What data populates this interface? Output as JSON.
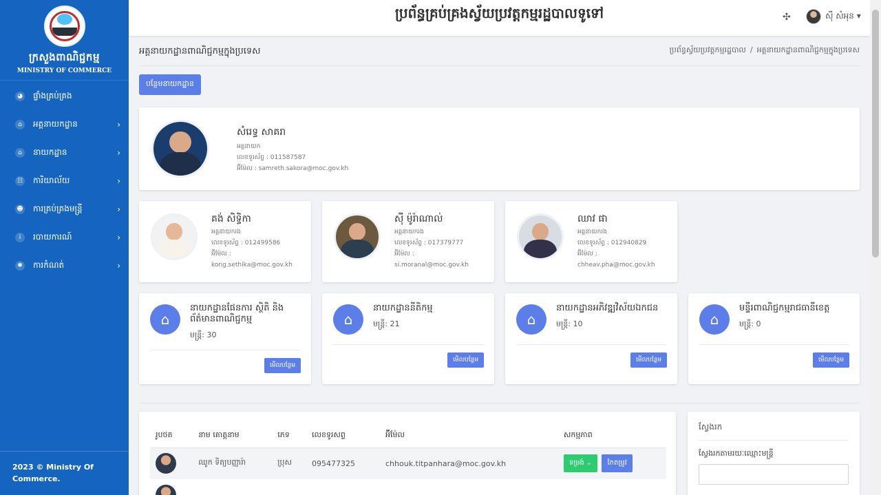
{
  "sidebar": {
    "brand_kh": "ក្រសួងពាណិជ្ជកម្ម",
    "brand_en": "MINISTRY OF COMMERCE",
    "items": [
      {
        "icon": "globe-icon",
        "glyph": "◕",
        "label": "ផ្ទាំងគ្រប់គ្រង"
      },
      {
        "icon": "bank-icon",
        "glyph": "⌂",
        "label": "អគ្គនាយកដ្ឋាន",
        "chevron": "›"
      },
      {
        "icon": "home-icon",
        "glyph": "⌂",
        "label": "នាយកដ្ឋាន",
        "chevron": "›"
      },
      {
        "icon": "sitemap-icon",
        "glyph": "☷",
        "label": "ការិយាល័យ",
        "chevron": "›"
      },
      {
        "icon": "users-icon",
        "glyph": "☻",
        "label": "ការគ្រប់គ្រងមន្ត្រី",
        "chevron": "›"
      },
      {
        "icon": "info-icon",
        "glyph": "i",
        "label": "របាយការណ៍",
        "chevron": "›"
      },
      {
        "icon": "gear-icon",
        "glyph": "✱",
        "label": "ការកំណត់",
        "chevron": "›"
      }
    ],
    "footer": "2023 © Ministry Of Commerce."
  },
  "header": {
    "title": "ប្រព័ន្ធគ្រប់គ្រងស្វ័យប្រវត្តកម្មរដ្ឋបាលទូទៅ",
    "user_name": "ស៊ី សំអុន ▾"
  },
  "page": {
    "title": "អគ្គនាយកដ្ឋានពាណិជ្ជកម្មក្នុងប្រទេស",
    "breadcrumb": [
      "ប្រព័ន្ធស្វ័យប្រវត្តកម្មរដ្ឋបាល",
      "អគ្គនាយកដ្ឋានពាណិជ្ជកម្មក្នុងប្រទេស"
    ],
    "breadcrumb_sep": "/",
    "add_button": "បន្ថែមនាយកដ្ឋាន"
  },
  "director": {
    "name": "សំរេទ្ធ សាគរា",
    "role": "អគ្គនាយក",
    "phone": "លេខទូរស័ព្ទ : 011587587",
    "email": "អ៊ីម៉ែល : samreth.sakora@moc.gov.kh"
  },
  "deputies": [
    {
      "name": "គង់ សិទ្ធិកា",
      "role": "អគ្គនាយករង",
      "phone": "លេខទូរស័ព្ទ : 012499586",
      "email_label": "អ៊ីម៉ែល :",
      "email": "kong.sethika@moc.gov.kh"
    },
    {
      "name": "ស៊ី ម៉ូរ៉ាណាល់",
      "role": "អគ្គនាយករង",
      "phone": "លេខទូរស័ព្ទ : 017379777",
      "email_label": "អ៊ីម៉ែល :",
      "email": "si.moranal@moc.gov.kh"
    },
    {
      "name": "ឈាវ ផា",
      "role": "អគ្គនាយករង",
      "phone": "លេខទូរស័ព្ទ : 012940829",
      "email_label": "អ៊ីម៉ែល :",
      "email": "chheav.pha@moc.gov.kh"
    }
  ],
  "departments": [
    {
      "name": "នាយកដ្ឋានផែនការ ស្ថិតិ និងព័ត៌មានពាណិជ្ជកម្ម",
      "count": "មន្ត្រី: 30",
      "button": "មើលបន្ថែម"
    },
    {
      "name": "នាយកដ្ឋាននីតិកម្ម",
      "count": "មន្ត្រី: 21",
      "button": "មើលបន្ថែម"
    },
    {
      "name": "នាយកដ្ឋានអភិវឌ្ឍវិស័យឯកជន",
      "count": "មន្ត្រី: 10",
      "button": "មើលបន្ថែម"
    },
    {
      "name": "មន្ទីរពាណិជ្ជកម្មរាជធានីខេត្ត",
      "count": "មន្ត្រី: 0",
      "button": "មើលបន្ថែម"
    }
  ],
  "table": {
    "columns": [
      "រូបថត",
      "នាម គោត្តនាម",
      "ភេទ",
      "លេខទូរសព្ទ",
      "អ៊ីម៉ែល",
      "សកម្មភាព"
    ],
    "rows": [
      {
        "name": "ឈូក ទិត្យបញ្ញារ៉ា",
        "gender": "ប្រុស",
        "phone": "095477325",
        "email": "chhouk.titpanhara@moc.gov.kh",
        "detail_button": "ទម្រង់ ⌄",
        "edit_button": "កែតម្រូវ"
      }
    ]
  },
  "search": {
    "title": "ស្វែងរក",
    "label": "ស្វែងរកតាមរយៈឈ្មោះមន្ត្រី",
    "placeholder": ""
  }
}
